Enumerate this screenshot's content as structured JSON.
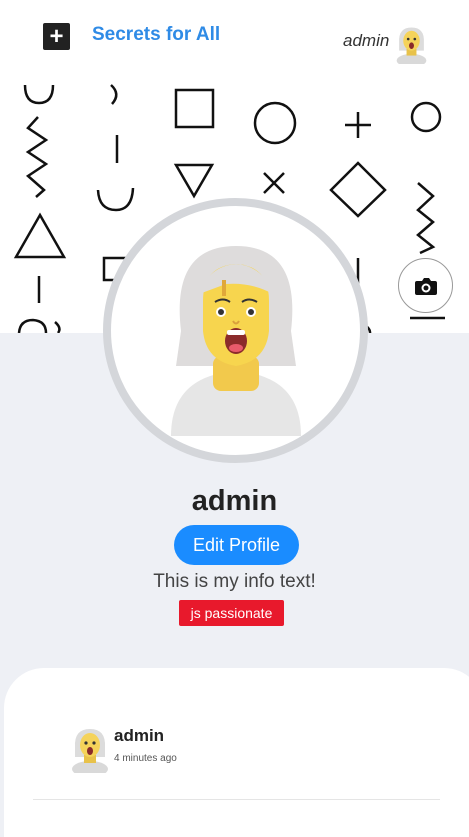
{
  "header": {
    "brand": "Secrets for All",
    "user_name": "admin"
  },
  "profile": {
    "name": "admin",
    "edit_label": "Edit Profile",
    "info": "This is my info text!",
    "tag": "js passionate"
  },
  "post": {
    "user": "admin",
    "time": "4 minutes ago"
  },
  "colors": {
    "brand": "#2f8be6",
    "button": "#1a8cff",
    "tag": "#e8192c",
    "profile_bg": "#eef0f5"
  },
  "icons": {
    "add": "plus-icon",
    "camera": "camera-icon",
    "avatar": "emoji-avatar"
  }
}
